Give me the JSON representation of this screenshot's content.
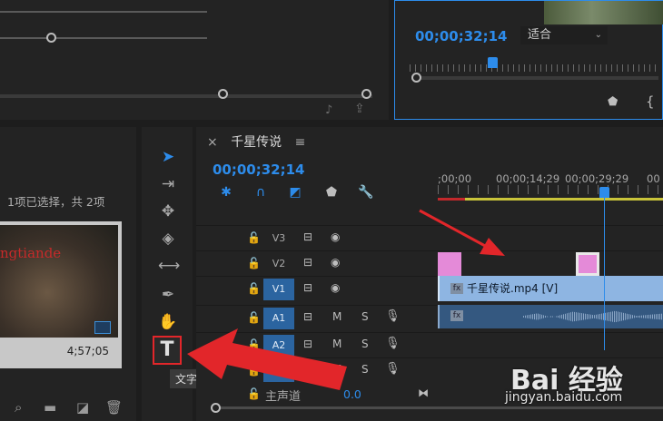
{
  "program_monitor": {
    "timecode": "00;00;32;14",
    "fit_select": "适合"
  },
  "project_panel": {
    "status": "1项已选择，共 2项",
    "thumb_overlay_text": "ngtiande",
    "thumb_duration": "4;57;05"
  },
  "tools": {
    "text_tool_glyph": "T",
    "tooltip": "文字工具 (T)"
  },
  "timeline": {
    "sequence_name": "千星传说",
    "close_glyph": "×",
    "menu_glyph": "≡",
    "timecode": "00;00;32;14",
    "ruler_labels": [
      ";00;00",
      "00;00;14;29",
      "00;00;29;29",
      "00"
    ],
    "tracks": {
      "v3": "V3",
      "v2": "V2",
      "v1": "V1",
      "a1": "A1",
      "a2": "A2"
    },
    "mute": "M",
    "solo": "S",
    "clip_v1": "千星传说.mp4 [V]",
    "fx": "fx",
    "master_label": "主声道",
    "master_value": "0.0"
  },
  "watermark": {
    "logo": "Bai 经验",
    "url": "jingyan.baidu.com"
  },
  "colors": {
    "accent": "#2d8ceb",
    "highlight_red": "#e2262a",
    "clip_pink": "#e48ad8",
    "clip_blue": "#8eb5e2"
  }
}
